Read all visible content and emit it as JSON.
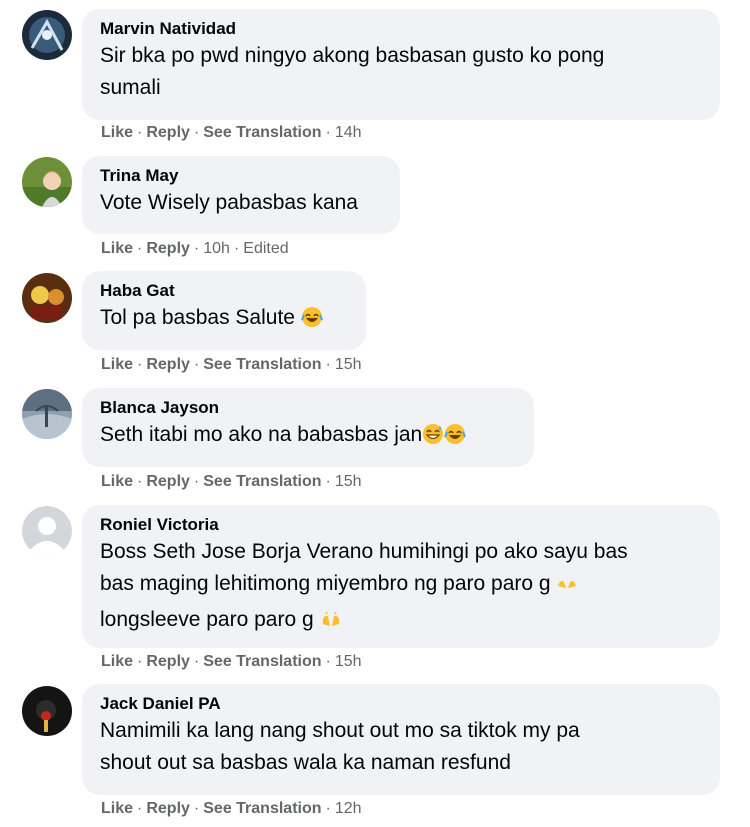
{
  "comments": [
    {
      "author": "Marvin Natividad",
      "lines": [
        "Sir bka po pwd ningyo akong basbasan gusto ko pong",
        "sumali"
      ],
      "actions": {
        "like": "Like",
        "reply": "Reply",
        "translate": "See Translation",
        "time": "14h"
      }
    },
    {
      "author": "Trina May",
      "lines": [
        "Vote Wisely pabasbas kana"
      ],
      "actions": {
        "like": "Like",
        "reply": "Reply",
        "time": "10h",
        "edited": "Edited"
      }
    },
    {
      "author": "Haba Gat",
      "lines": [
        "Tol pa basbas Salute"
      ],
      "actions": {
        "like": "Like",
        "reply": "Reply",
        "translate": "See Translation",
        "time": "15h"
      }
    },
    {
      "author": "Blanca Jayson",
      "lines": [
        "Seth itabi mo ako na babasbas jan"
      ],
      "actions": {
        "like": "Like",
        "reply": "Reply",
        "translate": "See Translation",
        "time": "15h"
      }
    },
    {
      "author": "Roniel Victoria",
      "lines": [
        "Boss Seth Jose Borja Verano humihingi po ako sayu bas",
        "bas maging lehitimong miyembro ng paro paro g",
        "longsleeve paro paro g"
      ],
      "actions": {
        "like": "Like",
        "reply": "Reply",
        "translate": "See Translation",
        "time": "15h"
      }
    },
    {
      "author": "Jack Daniel PA",
      "lines": [
        "Namimili ka lang nang shout out mo sa tiktok my pa",
        "shout out sa basbas wala ka naman resfund"
      ],
      "actions": {
        "like": "Like",
        "reply": "Reply",
        "translate": "See Translation",
        "time": "12h"
      }
    }
  ],
  "separator": "·",
  "colors": {
    "bubble": "#f0f2f5",
    "meta": "#65676b",
    "text": "#050505"
  },
  "icons": [
    "laughing-emoji-icon",
    "grinning-sweat-emoji-icon",
    "raising-hands-emoji-icon",
    "default-avatar-icon"
  ]
}
